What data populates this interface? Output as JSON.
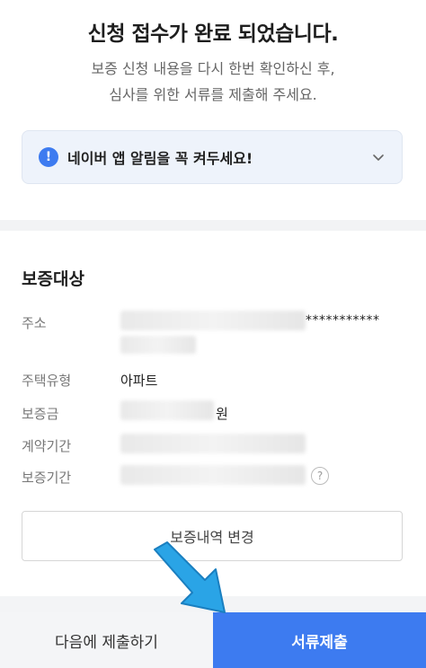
{
  "header": {
    "title": "신청 접수가 완료 되었습니다.",
    "subtitle_line1": "보증 신청 내용을 다시 한번 확인하신 후,",
    "subtitle_line2": "심사를 위한 서류를 제출해 주세요."
  },
  "notice": {
    "icon_text": "!",
    "text": "네이버 앱 알림을 꼭 켜두세요!"
  },
  "section": {
    "title": "보증대상",
    "rows": {
      "address": {
        "label": "주소",
        "masked_suffix": "***********"
      },
      "housing_type": {
        "label": "주택유형",
        "value": "아파트"
      },
      "deposit": {
        "label": "보증금",
        "unit": "원"
      },
      "contract_period": {
        "label": "계약기간"
      },
      "guarantee_period": {
        "label": "보증기간",
        "help_icon_text": "?"
      }
    },
    "change_button": "보증내역 변경"
  },
  "footer": {
    "later_button": "다음에 제출하기",
    "submit_button": "서류제출"
  },
  "colors": {
    "accent": "#3d7bf0",
    "arrow": "#2aa4e6"
  },
  "icons": [
    "info-icon",
    "chevron-down-icon",
    "help-icon",
    "pointer-arrow-icon"
  ]
}
